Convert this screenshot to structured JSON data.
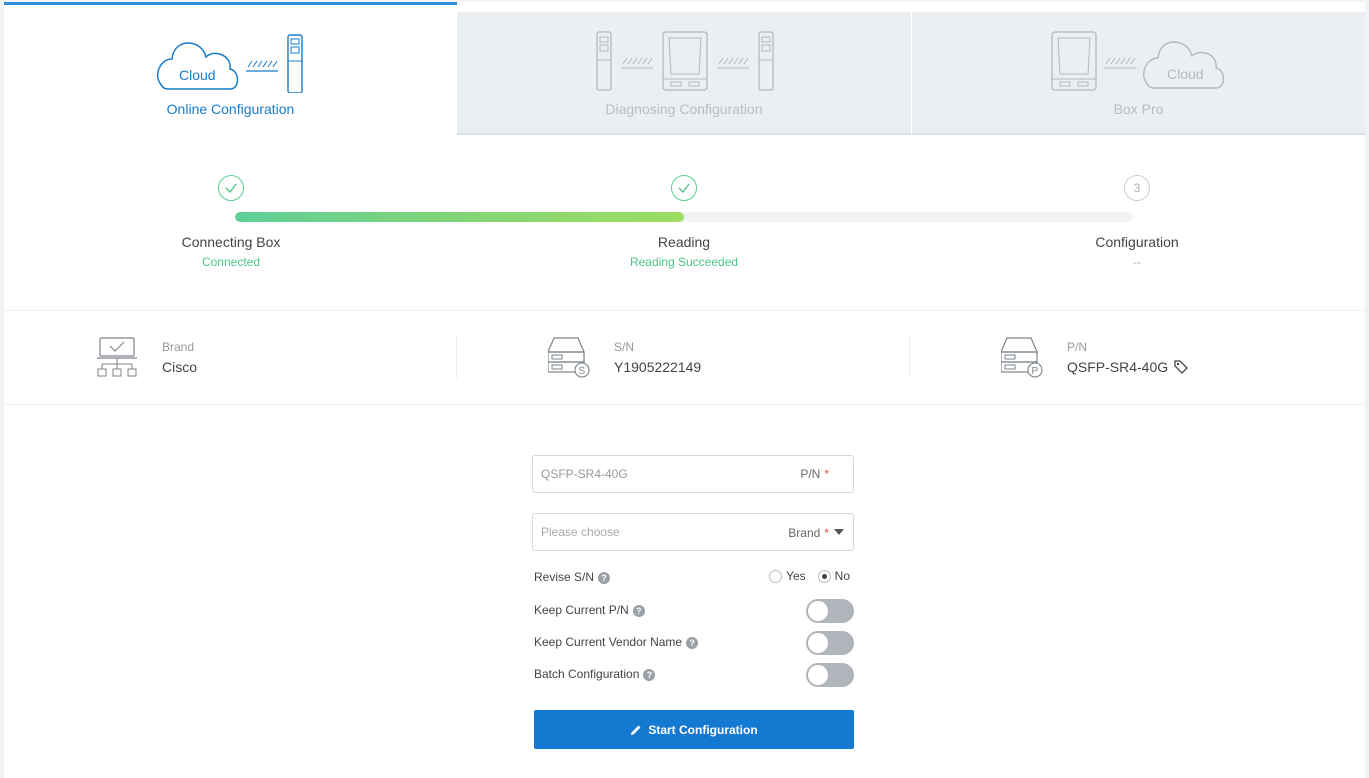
{
  "tabs": [
    {
      "label": "Online Configuration",
      "icon": "cloud-to-module-icon",
      "cloud_text": "Cloud",
      "active": true
    },
    {
      "label": "Diagnosing Configuration",
      "icon": "module-box-module-icon",
      "active": false
    },
    {
      "label": "Box Pro",
      "icon": "box-to-cloud-icon",
      "cloud_text": "Cloud",
      "active": false
    }
  ],
  "steps": [
    {
      "title": "Connecting Box",
      "status": "Connected",
      "done": true
    },
    {
      "title": "Reading",
      "status": "Reading Succeeded",
      "done": true
    },
    {
      "title": "Configuration",
      "status": "--",
      "done": false,
      "number": "3"
    }
  ],
  "progress_fraction": 0.5,
  "info": {
    "brand": {
      "label": "Brand",
      "value": "Cisco",
      "icon": "network-brand-icon"
    },
    "sn": {
      "label": "S/N",
      "value": "Y1905222149",
      "icon": "device-sn-icon"
    },
    "pn": {
      "label": "P/N",
      "value": "QSFP-SR4-40G",
      "icon": "device-pn-icon",
      "tag_icon": "tag-icon"
    }
  },
  "form": {
    "pn_field": {
      "value": "QSFP-SR4-40G",
      "tag": "P/N",
      "required": "*"
    },
    "brand_field": {
      "placeholder": "Please choose",
      "tag": "Brand",
      "required": "*"
    },
    "revise_sn": {
      "label": "Revise S/N",
      "help": "?",
      "yes": "Yes",
      "no": "No",
      "selected": "No"
    },
    "keep_pn": {
      "label": "Keep Current P/N",
      "help": "?",
      "on": false
    },
    "keep_vendor": {
      "label": "Keep Current Vendor Name",
      "help": "?",
      "on": false
    },
    "batch": {
      "label": "Batch Configuration",
      "help": "?",
      "on": false
    },
    "start_button": "Start Configuration"
  },
  "colors": {
    "accent": "#1479d1",
    "success": "#4bc586",
    "tab_inactive": "#eceff2"
  }
}
